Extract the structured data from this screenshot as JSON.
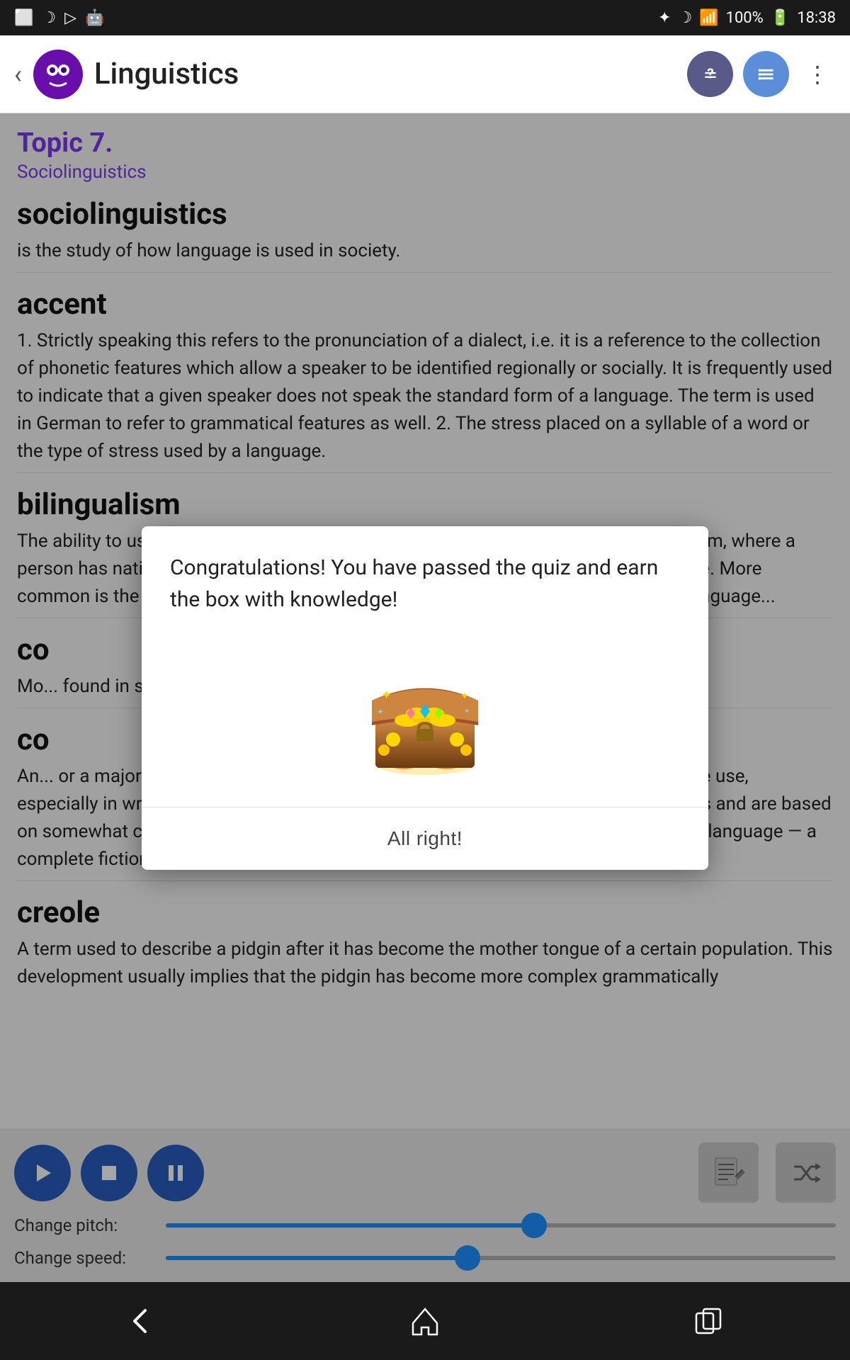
{
  "statusBar": {
    "time": "18:38",
    "battery": "100%",
    "wifi": true,
    "bluetooth": true
  },
  "appBar": {
    "title": "Linguistics",
    "backIcon": "‹",
    "moreIcon": "⋮"
  },
  "content": {
    "topicNumber": "Topic 7.",
    "topicSubtitle": "Sociolinguistics",
    "terms": [
      {
        "term": "sociolinguistics",
        "definition": "is the study of how language is used in society."
      },
      {
        "term": "accent",
        "definition": "1. Strictly speaking this refers to the pronunciation of a dialect, i.e. it is a reference to the collection of phonetic features which allow a speaker to be identified regionally or socially. It is frequently used to indicate that a given speaker does not speak the standard form of a language. The term is used in German to refer to grammatical features as well. 2. The stress placed on a syllable of a word or the type of stress used by a language."
      },
      {
        "term": "bilingualism",
        "definition": "The..."
      },
      {
        "term": "co",
        "definition": "Mo... fou... son... fai..."
      },
      {
        "term": "co",
        "definition": "An... or a major publishing house, which attempts to lay down rigid rules for language use, especially in written form. Notions of correctness show a high degree of arbitrariness and are based on somewhat conservative usage, intended to maintain an unchanging standard in a language — a complete fiction."
      },
      {
        "term": "creole",
        "definition": "A term used to describe a pidgin after it has become the mother tongue of a certain population. This development usually implies that the pidgin has become more complex grammatically"
      }
    ]
  },
  "dialog": {
    "message": "Congratulations! You have passed the quiz and earn the box with knowledge!",
    "buttonLabel": "All right!"
  },
  "controls": {
    "changePitchLabel": "Change pitch:",
    "changeSpeedLabel": "Change speed:",
    "pitchValue": 55,
    "speedValue": 45
  },
  "bottomNav": {
    "backIcon": "back-icon",
    "homeIcon": "home-icon",
    "recentIcon": "recent-apps-icon"
  },
  "icons": {
    "quiz": "quiz-icon",
    "list": "list-icon",
    "more": "more-icon"
  }
}
